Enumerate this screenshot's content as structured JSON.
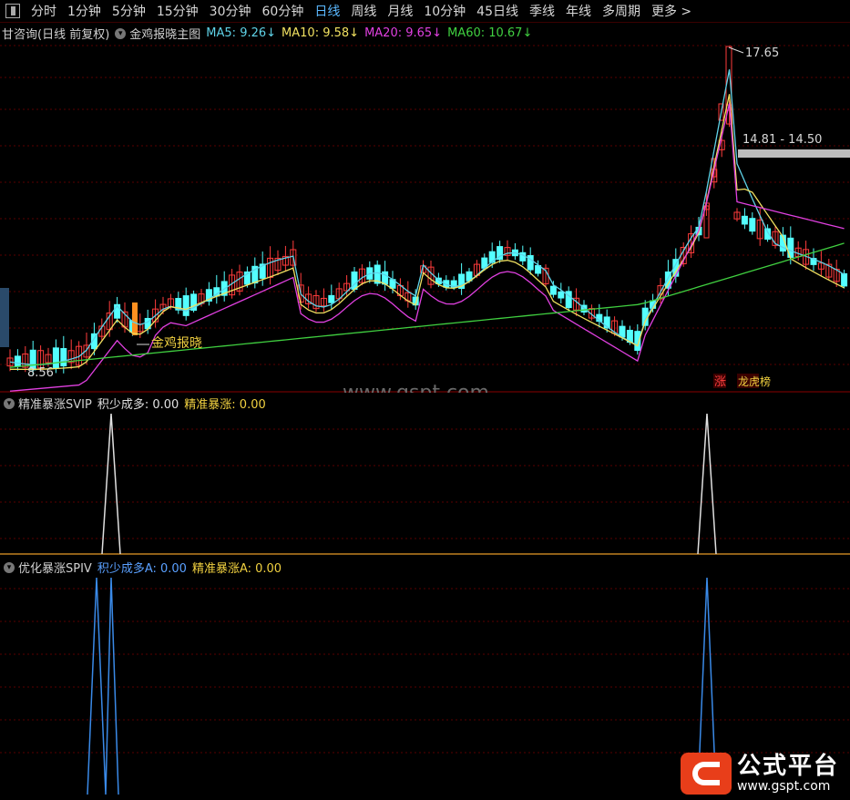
{
  "toolbar": {
    "tabs": [
      "分时",
      "1分钟",
      "5分钟",
      "15分钟",
      "30分钟",
      "60分钟",
      "日线",
      "周线",
      "月线",
      "10分钟",
      "45日线",
      "季线",
      "年线",
      "多周期",
      "更多 >"
    ],
    "active_tab": "日线"
  },
  "main_panel": {
    "title": "甘咨询(日线 前复权)",
    "indicator": "金鸡报晓主图",
    "ma": [
      {
        "label": "MA5: 9.26",
        "arrow": "↓",
        "color": "#5fd3e8"
      },
      {
        "label": "MA10: 9.58",
        "arrow": "↓",
        "color": "#f0e060"
      },
      {
        "label": "MA20: 9.65",
        "arrow": "↓",
        "color": "#e040e0"
      },
      {
        "label": "MA60: 10.67",
        "arrow": "↓",
        "color": "#40d040"
      }
    ],
    "high_label": "17.65",
    "low_label": "8.56",
    "range_label": "14.81 - 14.50",
    "signal_label": "金鸡报晓",
    "badge_zhang": "涨",
    "badge_dragon": "龙虎榜",
    "watermark": "www.gspt.com"
  },
  "panel2": {
    "title": "精准暴涨SVIP",
    "values": [
      {
        "label": "积少成多: 0.00",
        "color": "#e0e0e0"
      },
      {
        "label": "精准暴涨: 0.00",
        "color": "#f0d040"
      }
    ]
  },
  "panel3": {
    "title": "优化暴涨SPIV",
    "values": [
      {
        "label": "积少成多A: 0.00",
        "color": "#5aa0ff"
      },
      {
        "label": "精准暴涨A: 0.00",
        "color": "#f0d040"
      }
    ]
  },
  "logo": {
    "name": "公式平台",
    "url": "www.gspt.com"
  },
  "colors": {
    "up": "#ff3c3c",
    "down": "#54ffff",
    "grid": "#5a0000",
    "border": "#8a0000"
  }
}
